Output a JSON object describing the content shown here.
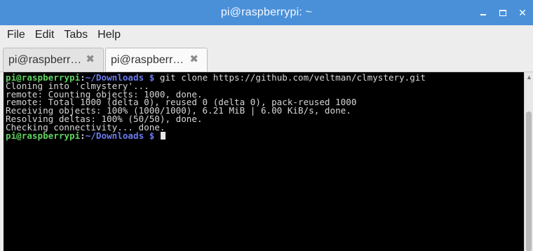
{
  "window": {
    "title": "pi@raspberrypi: ~",
    "accent_color": "#4a90d9",
    "controls": {
      "minimize_icon": "minimize-icon",
      "maximize_icon": "maximize-icon",
      "close_icon": "close-icon",
      "close_glyph": "✕"
    }
  },
  "menubar": {
    "items": [
      "File",
      "Edit",
      "Tabs",
      "Help"
    ]
  },
  "tabs": [
    {
      "label": "pi@raspberr…",
      "close": "✖",
      "active": false
    },
    {
      "label": "pi@raspberr…",
      "close": "✖",
      "active": true
    }
  ],
  "terminal": {
    "background": "#000000",
    "prompt_user": "pi@raspberrypi",
    "prompt_sep": ":",
    "prompt_path": "~/Downloads $",
    "command": " git clone https://github.com/veltman/clmystery.git",
    "output": [
      "Cloning into 'clmystery'...",
      "remote: Counting objects: 1000, done.",
      "remote: Total 1000 (delta 0), reused 0 (delta 0), pack-reused 1000",
      "Receiving objects: 100% (1000/1000), 6.21 MiB | 6.00 KiB/s, done.",
      "Resolving deltas: 100% (50/50), done.",
      "Checking connectivity... done."
    ]
  },
  "scrollbar": {
    "up_glyph": "▲"
  }
}
